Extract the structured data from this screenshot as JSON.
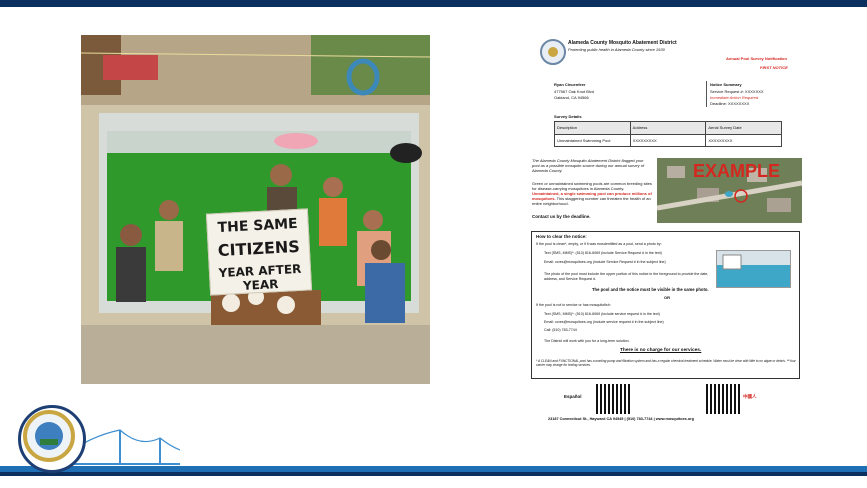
{
  "photo": {
    "sign": {
      "line1": "THE SAME",
      "line2": "CITIZENS",
      "line3": "YEAR AFTER YEAR"
    }
  },
  "document": {
    "header": {
      "org_name": "Alameda County Mosquito Abatement District",
      "tagline": "Protecting public health in Alameda County since 1930",
      "notice_title": "Annual Pool Survey Notification",
      "notice_level": "FIRST NOTICE"
    },
    "recipient": {
      "name": "Ryan Cleuenfeer",
      "street": "477567 Oak Knot Blvd",
      "city": "Oakland, CA 94566"
    },
    "summary": {
      "title": "Notice Summary",
      "service_request": "Service Request #: XXXXXXX",
      "action": "Immediate Action Required",
      "deadline": "Deadline: XXXXXXXX"
    },
    "survey": {
      "title": "Survey Details",
      "headers": [
        "Description",
        "Address",
        "Aerial Survey Date"
      ],
      "rows": [
        [
          "Unmaintained Swimming Pool",
          "XXXXXXXXX",
          "XXXXXXXXX"
        ]
      ]
    },
    "body": {
      "p1": "The Alameda County Mosquito Abatement District flagged your pool as a possible mosquito source during our annual survey of Alameda County.",
      "p2": "Green or unmaintained swimming pools are common breeding sites for disease-carrying mosquitoes in Alameda County.",
      "p2_red": "Unmaintained, a single swimming pool can produce millions of mosquitoes.",
      "p2_tail": "This staggering number can threaten the health of an entire neighborhood.",
      "contact": "Contact us by the deadline."
    },
    "aerial_label": "EXAMPLE",
    "clear": {
      "title": "How to clear the notice:",
      "intro": "If the pool is clean*, empty, or if it was mosdentified as a pool, send a photo by:",
      "b1": "Text (SMS, MMS)*: (510) 816-6069  (include Service Request # in the text)",
      "b2": "Email: ccres@mosquitoes.org  (include Service Request # in the subject line)",
      "photo_note": "The photo of the pool must include the upper portion of this notice in the foreground to provide the date, address, and Service Request #.",
      "visible": "The pool and the notice must be visible in the same photo.",
      "or": "OR",
      "intro2": "If the pool is not in service or has mosquitofish:",
      "c1": "Text (SMS, MMS)*: (510) 816-6069  (include service request # in the text)",
      "c2": "Email: ccres@mosquitoes.org  (include service request # in the subject line)",
      "c3": "Call: (510) 783-7744",
      "district_line": "The District will work with you for a long-term solution.",
      "no_charge": "There is no charge for our services.",
      "footnote": "* A CLEAN and FUNCTIONAL pool has a working pump and filtration system and has a regular chemical treatment schedule. Water must be clear with little to no algae or debris.   **Your carrier may charge for texting services."
    },
    "footer": {
      "espanol": "Español",
      "chinese": "中國人",
      "address": "23187 Connecticut St., Hayward CA 94545   |   (510) 783-7744   |   www.mosquitoes.org"
    }
  },
  "colors": {
    "top_rule": "#0b2f5e",
    "band": "#1f6fb5",
    "notice_red": "#d4271f",
    "link_blue": "#1a4fb8"
  }
}
